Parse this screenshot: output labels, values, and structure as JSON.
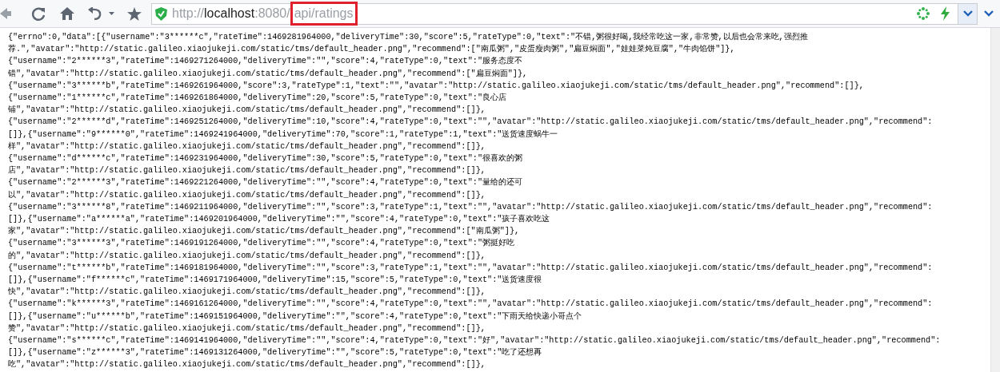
{
  "toolbar": {
    "address_bar": {
      "scheme": "http://",
      "host": "localhost",
      "port_path": ":8080/",
      "highlighted_path": "api/ratings"
    }
  },
  "response_lines": [
    "{\"errno\":0,\"data\":[{\"username\":\"3******c\",\"rateTime\":1469281964000,\"deliveryTime\":30,\"score\":5,\"rateType\":0,\"text\":\"不错,粥很好喝,我经常吃这一家,非常赞,以后也会常来吃,强烈推",
    "荐.\",\"avatar\":\"http://static.galileo.xiaojukeji.com/static/tms/default_header.png\",\"recommend\":[\"南瓜粥\",\"皮蛋瘦肉粥\",\"扁豆焖面\",\"娃娃菜炖豆腐\",\"牛肉馅饼\"]},",
    "{\"username\":\"2******3\",\"rateTime\":1469271264000,\"deliveryTime\":\"\",\"score\":4,\"rateType\":0,\"text\":\"服务态度不",
    "错\",\"avatar\":\"http://static.galileo.xiaojukeji.com/static/tms/default_header.png\",\"recommend\":[\"扁豆焖面\"]},",
    "{\"username\":\"3******b\",\"rateTime\":1469261964000,\"score\":3,\"rateType\":1,\"text\":\"\",\"avatar\":\"http://static.galileo.xiaojukeji.com/static/tms/default_header.png\",\"recommend\":[]},",
    "{\"username\":\"1******c\",\"rateTime\":1469261864000,\"deliveryTime\":20,\"score\":5,\"rateType\":0,\"text\":\"良心店",
    "铺\",\"avatar\":\"http://static.galileo.xiaojukeji.com/static/tms/default_header.png\",\"recommend\":[]},",
    "{\"username\":\"2******d\",\"rateTime\":1469251264000,\"deliveryTime\":10,\"score\":4,\"rateType\":0,\"text\":\"\",\"avatar\":\"http://static.galileo.xiaojukeji.com/static/tms/default_header.png\",\"recommend\":",
    "[]},{\"username\":\"9******0\",\"rateTime\":1469241964000,\"deliveryTime\":70,\"score\":1,\"rateType\":1,\"text\":\"送货速度蜗牛一",
    "样\",\"avatar\":\"http://static.galileo.xiaojukeji.com/static/tms/default_header.png\",\"recommend\":[]},",
    "{\"username\":\"d******c\",\"rateTime\":1469231964000,\"deliveryTime\":30,\"score\":5,\"rateType\":0,\"text\":\"很喜欢的粥",
    "店\",\"avatar\":\"http://static.galileo.xiaojukeji.com/static/tms/default_header.png\",\"recommend\":[]},",
    "{\"username\":\"2******3\",\"rateTime\":1469221264000,\"deliveryTime\":\"\",\"score\":4,\"rateType\":0,\"text\":\"量给的还可",
    "以\",\"avatar\":\"http://static.galileo.xiaojukeji.com/static/tms/default_header.png\",\"recommend\":[]},",
    "{\"username\":\"3******8\",\"rateTime\":1469211964000,\"deliveryTime\":\"\",\"score\":3,\"rateType\":1,\"text\":\"\",\"avatar\":\"http://static.galileo.xiaojukeji.com/static/tms/default_header.png\",\"recommend\":",
    "[]},{\"username\":\"a******a\",\"rateTime\":1469201964000,\"deliveryTime\":\"\",\"score\":4,\"rateType\":0,\"text\":\"孩子喜欢吃这",
    "家\",\"avatar\":\"http://static.galileo.xiaojukeji.com/static/tms/default_header.png\",\"recommend\":[\"南瓜粥\"]},",
    "{\"username\":\"3******3\",\"rateTime\":1469191264000,\"deliveryTime\":\"\",\"score\":4,\"rateType\":0,\"text\":\"粥挺好吃",
    "的\",\"avatar\":\"http://static.galileo.xiaojukeji.com/static/tms/default_header.png\",\"recommend\":[]},",
    "{\"username\":\"t******b\",\"rateTime\":1469181964000,\"deliveryTime\":\"\",\"score\":3,\"rateType\":1,\"text\":\"\",\"avatar\":\"http://static.galileo.xiaojukeji.com/static/tms/default_header.png\",\"recommend\":",
    "[]},{\"username\":\"f******c\",\"rateTime\":1469171964000,\"deliveryTime\":15,\"score\":5,\"rateType\":0,\"text\":\"送货速度很",
    "快\",\"avatar\":\"http://static.galileo.xiaojukeji.com/static/tms/default_header.png\",\"recommend\":[]},",
    "{\"username\":\"k******3\",\"rateTime\":1469161264000,\"deliveryTime\":\"\",\"score\":4,\"rateType\":0,\"text\":\"\",\"avatar\":\"http://static.galileo.xiaojukeji.com/static/tms/default_header.png\",\"recommend\":",
    "[]},{\"username\":\"u******b\",\"rateTime\":1469151964000,\"deliveryTime\":\"\",\"score\":4,\"rateType\":0,\"text\":\"下雨天给快递小哥点个",
    "赞\",\"avatar\":\"http://static.galileo.xiaojukeji.com/static/tms/default_header.png\",\"recommend\":[]},",
    "{\"username\":\"s******c\",\"rateTime\":1469141964000,\"deliveryTime\":\"\",\"score\":4,\"rateType\":0,\"text\":\"好\",\"avatar\":\"http://static.galileo.xiaojukeji.com/static/tms/default_header.png\",\"recommend\":",
    "[]},{\"username\":\"z******3\",\"rateTime\":1469131264000,\"deliveryTime\":\"\",\"score\":5,\"rateType\":0,\"text\":\"吃了还想再",
    "吃\",\"avatar\":\"http://static.galileo.xiaojukeji.com/static/tms/default_header.png\",\"recommend\":[]},"
  ]
}
